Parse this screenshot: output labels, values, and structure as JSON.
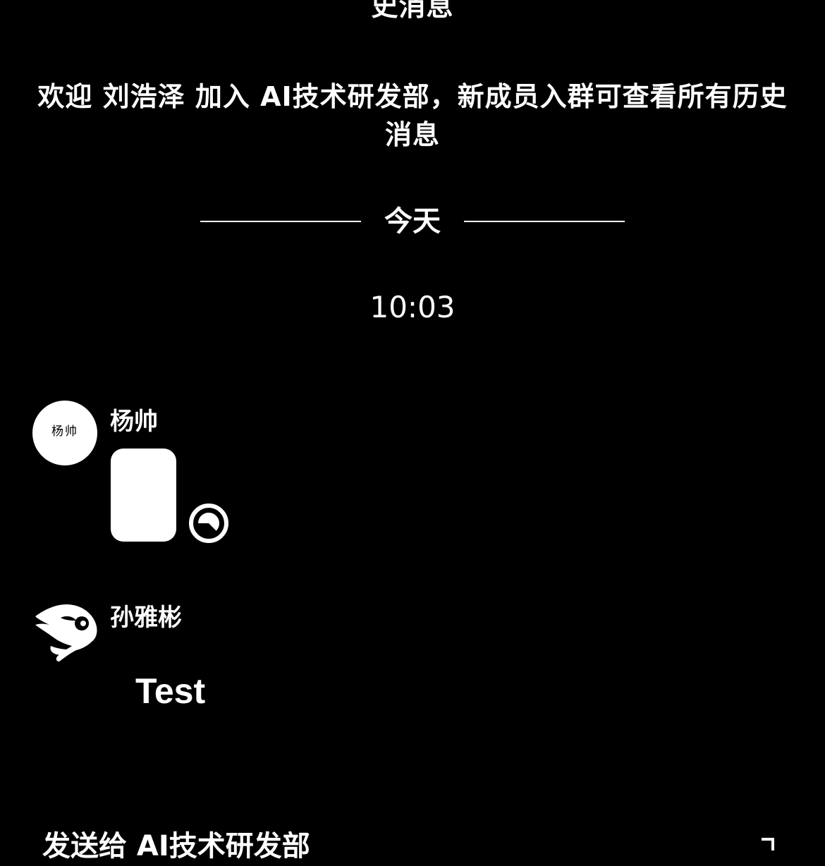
{
  "chat": {
    "system_messages": [
      {
        "text": "史消息"
      },
      {
        "text": "欢迎 刘浩泽 加入 AI技术研发部，新成员入群可查看所有历史消息"
      }
    ],
    "date_divider": "今天",
    "time_label": "10:03",
    "messages": [
      {
        "sender": "杨帅",
        "avatar_text": "杨帅",
        "type": "image",
        "status_icon": "pending-clock-icon"
      },
      {
        "sender": "孙雅彬",
        "avatar_icon": "cartoon-character-avatar",
        "type": "text",
        "text": "Test"
      }
    ]
  },
  "input": {
    "placeholder": "发送给 AI技术研发部",
    "action_icon": "expand-icon"
  },
  "colors": {
    "background": "#000000",
    "foreground": "#ffffff"
  }
}
